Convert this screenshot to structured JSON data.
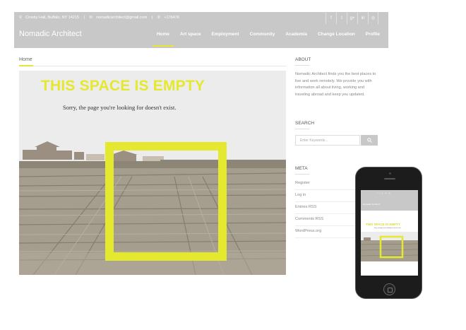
{
  "topbar": {
    "address": "Crosby Hall, Buffalo, NY 14215",
    "email": "nomadicarchitect@gmail.com",
    "phone": "+176476"
  },
  "socials": [
    {
      "name": "facebook-icon",
      "glyph": "f"
    },
    {
      "name": "twitter-icon",
      "glyph": "t"
    },
    {
      "name": "google-plus-icon",
      "glyph": "g+"
    },
    {
      "name": "linkedin-icon",
      "glyph": "in"
    },
    {
      "name": "instagram-icon",
      "glyph": "◎"
    }
  ],
  "brand": "Nomadic Architect",
  "nav": [
    "Home",
    "Art space",
    "Employment",
    "Community",
    "Academia",
    "Change Location",
    "Profile"
  ],
  "breadcrumb": "Home",
  "hero": {
    "title": "THIS SPACE IS EMPTY",
    "subtitle": "Sorry, the page you're looking for doesn't exist."
  },
  "sidebar": {
    "about_heading": "ABOUT",
    "about_text": "Nomadic Architect finds you the best places to live and work remotely. We provide you with information all about living, working and traveling abroad and keep you updated.",
    "search_heading": "SEARCH",
    "search_placeholder": "Enter Keywords...",
    "meta_heading": "META",
    "meta_items": [
      "Register",
      "Log in",
      "Entries RSS",
      "Comments RSS",
      "WordPress.org"
    ]
  },
  "phone_screen": {
    "brand": "Nomadic Architect",
    "title": "THIS SPACE IS EMPTY",
    "subtitle": "Sorry, the page you're looking for doesn't exist."
  },
  "colors": {
    "accent": "#e4e82e",
    "header_bg": "#c8c8c8"
  }
}
